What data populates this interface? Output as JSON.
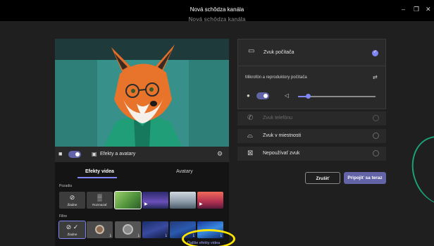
{
  "window": {
    "title": "Nová schôdza kanála",
    "title_ghost": "Nová schôdza kanála",
    "minimize_glyph": "–",
    "maximize_glyph": "❐",
    "close_glyph": "✕"
  },
  "video": {
    "camera_on": true,
    "effects_label": "Efekty a avatary",
    "tabs": [
      {
        "label": "Efekty videa",
        "active": true
      },
      {
        "label": "Avatary",
        "active": false
      }
    ],
    "backgrounds_label": "Pozadia",
    "backgrounds": [
      {
        "label": "Žiadne",
        "icon": "⊘"
      },
      {
        "label": "Rozmazať",
        "icon": "▒"
      }
    ],
    "filters_label": "Filtre",
    "filters": [
      {
        "label": "Žiadne",
        "icon": "⊘ ✓"
      }
    ],
    "more_effects": "Ďalšie efekty videa"
  },
  "audio": {
    "options": [
      {
        "label": "Zvuk počítača",
        "selected": true,
        "icon": "computer-audio-icon"
      },
      {
        "label": "Zvuk telefónu",
        "selected": false,
        "disabled": true,
        "icon": "phone-icon"
      },
      {
        "label": "Zvuk v miestnosti",
        "selected": false,
        "icon": "room-icon"
      },
      {
        "label": "Nepoužívať zvuk",
        "selected": false,
        "icon": "no-audio-icon"
      }
    ],
    "device_label": "Mikrofón a reproduktory počítača",
    "mic_on": true,
    "speaker_level": 0.13
  },
  "buttons": {
    "cancel": "Zrušiť",
    "join": "Pripojiť sa teraz"
  },
  "colors": {
    "accent": "#6264a7",
    "accent_light": "#7f85f5",
    "highlight": "#ffe600"
  }
}
